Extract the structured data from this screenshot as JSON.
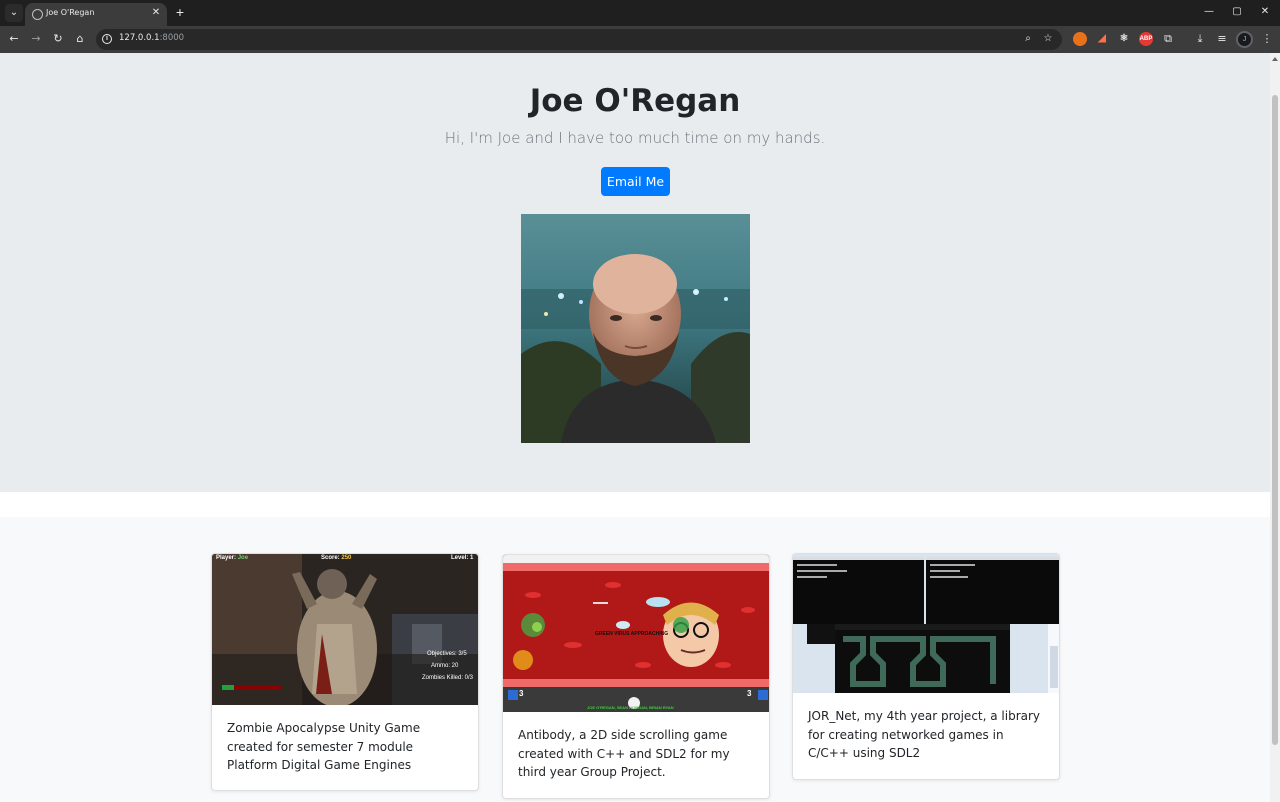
{
  "browser": {
    "tab_title": "Joe O'Regan",
    "tab_close": "✕",
    "new_tab": "+",
    "url_host": "127.0.0.1",
    "url_port": ":8000",
    "window_controls": {
      "minimize": "—",
      "maximize": "▢",
      "close": "✕"
    },
    "extensions": [
      "ABP"
    ],
    "profile_initial": "J"
  },
  "hero": {
    "title": "Joe O'Regan",
    "subtitle": "Hi, I'm Joe and I have too much time on my hands.",
    "email_button": "Email Me"
  },
  "cards": [
    {
      "text": "Zombie Apocalypse Unity Game created for semester 7 module Platform Digital Game Engines",
      "hud": {
        "player_label": "Player:",
        "player": "Joe",
        "score_label": "Score:",
        "score": "250",
        "level_label": "Level:",
        "level": "1",
        "objectives": "Objectives: 3/5",
        "ammo": "Ammo: 20",
        "zombies": "Zombies Killed: 0/3"
      }
    },
    {
      "text": "Antibody, a 2D side scrolling game created with C++ and SDL2 for my third year Group Project.",
      "hud": {
        "banner": "GREEN VIRUS APPROACHING",
        "footer": "JOE O'REGAN, SEAN HORGAN, BRIAN RYAN",
        "left_count": "3",
        "right_count": "3"
      }
    },
    {
      "text": "JOR_Net, my 4th year project, a library for creating networked games in C/C++ using SDL2"
    }
  ],
  "colors": {
    "primary": "#007bff",
    "jumbotron_bg": "#e9ecef",
    "album_bg": "#f8f9fa"
  }
}
